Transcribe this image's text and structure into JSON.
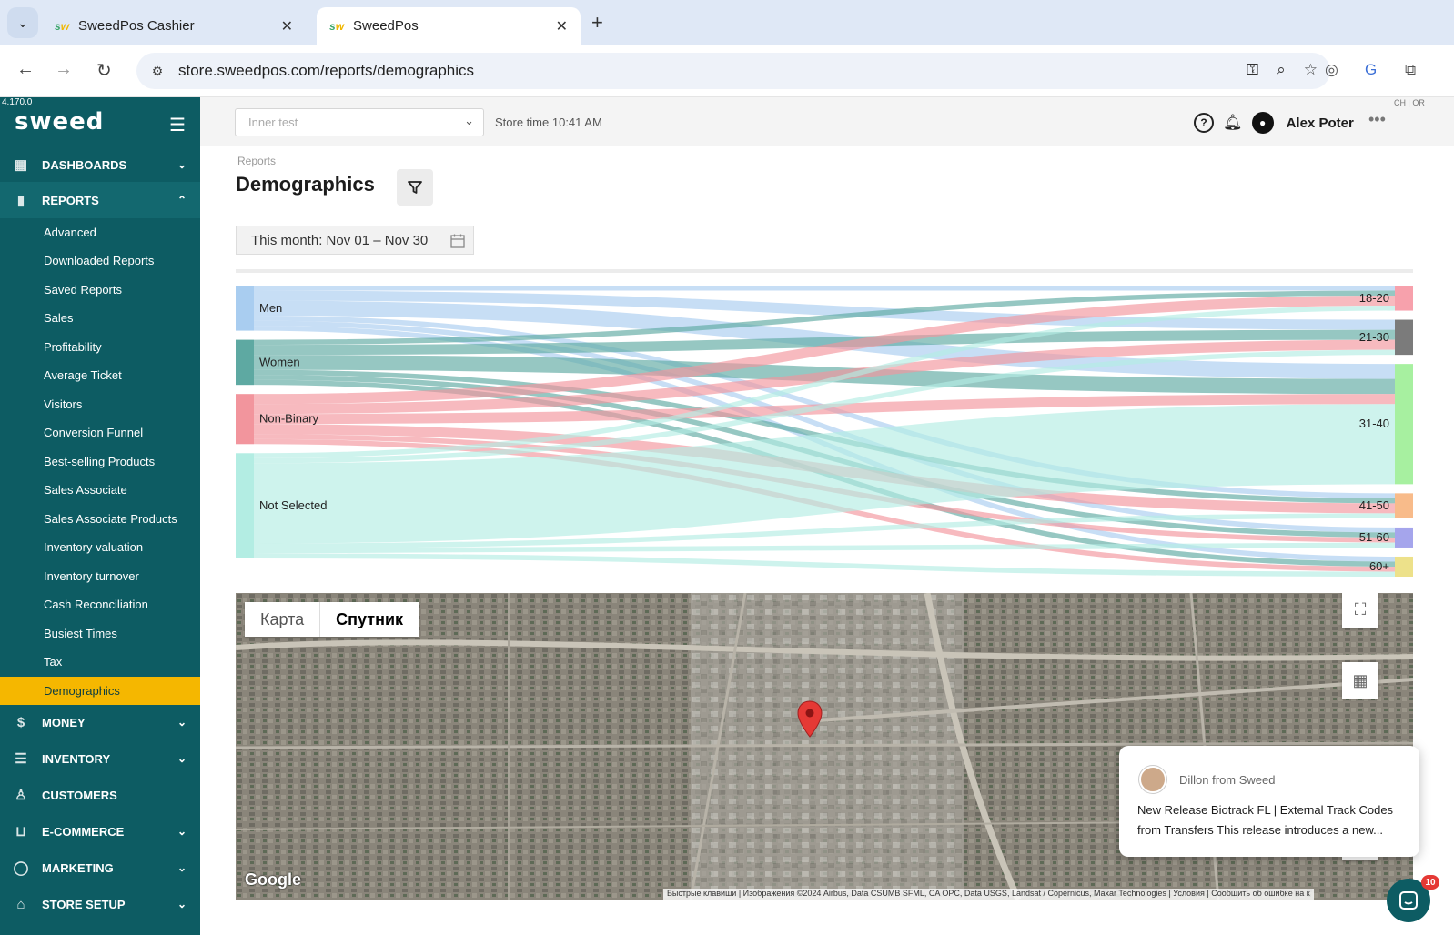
{
  "browser": {
    "tabs": [
      {
        "title": "SweedPos Cashier",
        "favicon": "sw",
        "active": false
      },
      {
        "title": "SweedPos",
        "favicon": "sw",
        "active": true
      }
    ],
    "url": "store.sweedpos.com/reports/demographics"
  },
  "app": {
    "version": "4.170.0",
    "logo": "sweed",
    "store_select": {
      "placeholder": "Inner test"
    },
    "store_time": "Store time 10:41 AM",
    "user": {
      "name": "Alex Poter"
    },
    "corner_tag": "CH | OR"
  },
  "sidebar": {
    "sections": [
      {
        "label": "DASHBOARDS",
        "icon": "grid-icon",
        "expanded": false
      },
      {
        "label": "REPORTS",
        "icon": "bar-chart-icon",
        "expanded": true
      },
      {
        "label": "MONEY",
        "icon": "dollar-icon",
        "expanded": false
      },
      {
        "label": "INVENTORY",
        "icon": "list-icon",
        "expanded": false
      },
      {
        "label": "CUSTOMERS",
        "icon": "user-icon",
        "expanded": false
      },
      {
        "label": "E-COMMERCE",
        "icon": "basket-icon",
        "expanded": false
      },
      {
        "label": "MARKETING",
        "icon": "chat-icon",
        "expanded": false
      },
      {
        "label": "STORE SETUP",
        "icon": "home-icon",
        "expanded": false
      }
    ],
    "report_items": [
      "Advanced",
      "Downloaded Reports",
      "Saved Reports",
      "Sales",
      "Profitability",
      "Average Ticket",
      "Visitors",
      "Conversion Funnel",
      "Best-selling Products",
      "Sales Associate",
      "Sales Associate Products",
      "Inventory valuation",
      "Inventory turnover",
      "Cash Reconciliation",
      "Busiest Times",
      "Tax",
      "Demographics"
    ],
    "active_item": "Demographics"
  },
  "page": {
    "breadcrumb": "Reports",
    "title": "Demographics",
    "date_range": "This month: Nov 01 – Nov 30"
  },
  "chart_data": {
    "type": "sankey",
    "sources": [
      {
        "name": "Men",
        "color": "#a9cdf0"
      },
      {
        "name": "Women",
        "color": "#5ea9a2"
      },
      {
        "name": "Non-Binary",
        "color": "#f2959d"
      },
      {
        "name": "Not Selected",
        "color": "#b3ede3"
      }
    ],
    "targets": [
      {
        "name": "18-20",
        "color": "#f7a1ac"
      },
      {
        "name": "21-30",
        "color": "#7b7b7b"
      },
      {
        "name": "31-40",
        "color": "#a7f0a0"
      },
      {
        "name": "41-50",
        "color": "#f8bb8a"
      },
      {
        "name": "51-60",
        "color": "#a5a5ec"
      },
      {
        "name": "60+",
        "color": "#ede18a"
      }
    ],
    "links": [
      {
        "source": "Men",
        "target": "18-20",
        "value": 1
      },
      {
        "source": "Men",
        "target": "21-30",
        "value": 2
      },
      {
        "source": "Men",
        "target": "31-40",
        "value": 3
      },
      {
        "source": "Men",
        "target": "41-50",
        "value": 1
      },
      {
        "source": "Men",
        "target": "51-60",
        "value": 1
      },
      {
        "source": "Men",
        "target": "60+",
        "value": 1
      },
      {
        "source": "Women",
        "target": "18-20",
        "value": 1
      },
      {
        "source": "Women",
        "target": "21-30",
        "value": 2
      },
      {
        "source": "Women",
        "target": "31-40",
        "value": 3
      },
      {
        "source": "Women",
        "target": "41-50",
        "value": 1
      },
      {
        "source": "Women",
        "target": "51-60",
        "value": 1
      },
      {
        "source": "Women",
        "target": "60+",
        "value": 1
      },
      {
        "source": "Non-Binary",
        "target": "18-20",
        "value": 2
      },
      {
        "source": "Non-Binary",
        "target": "21-30",
        "value": 2
      },
      {
        "source": "Non-Binary",
        "target": "31-40",
        "value": 2
      },
      {
        "source": "Non-Binary",
        "target": "41-50",
        "value": 2
      },
      {
        "source": "Non-Binary",
        "target": "51-60",
        "value": 1
      },
      {
        "source": "Non-Binary",
        "target": "60+",
        "value": 1
      },
      {
        "source": "Not Selected",
        "target": "18-20",
        "value": 1
      },
      {
        "source": "Not Selected",
        "target": "21-30",
        "value": 1
      },
      {
        "source": "Not Selected",
        "target": "31-40",
        "value": 16
      },
      {
        "source": "Not Selected",
        "target": "41-50",
        "value": 1
      },
      {
        "source": "Not Selected",
        "target": "51-60",
        "value": 1
      },
      {
        "source": "Not Selected",
        "target": "60+",
        "value": 1
      }
    ]
  },
  "map": {
    "tabs": [
      "Карта",
      "Спутник"
    ],
    "active_tab": "Спутник",
    "logo": "Google",
    "attribution": "Быстрые клавиши  |  Изображения ©2024 Airbus, Data CSUMB SFML, CA OPC, Data USGS, Landsat / Copernicus, Maxar Technologies  |  Условия  |  Сообщить об ошибке на к"
  },
  "chat": {
    "from": "Dillon from Sweed",
    "message": "New Release Biotrack FL | External Track Codes from Transfers This release introduces a new...",
    "badge": "10"
  }
}
